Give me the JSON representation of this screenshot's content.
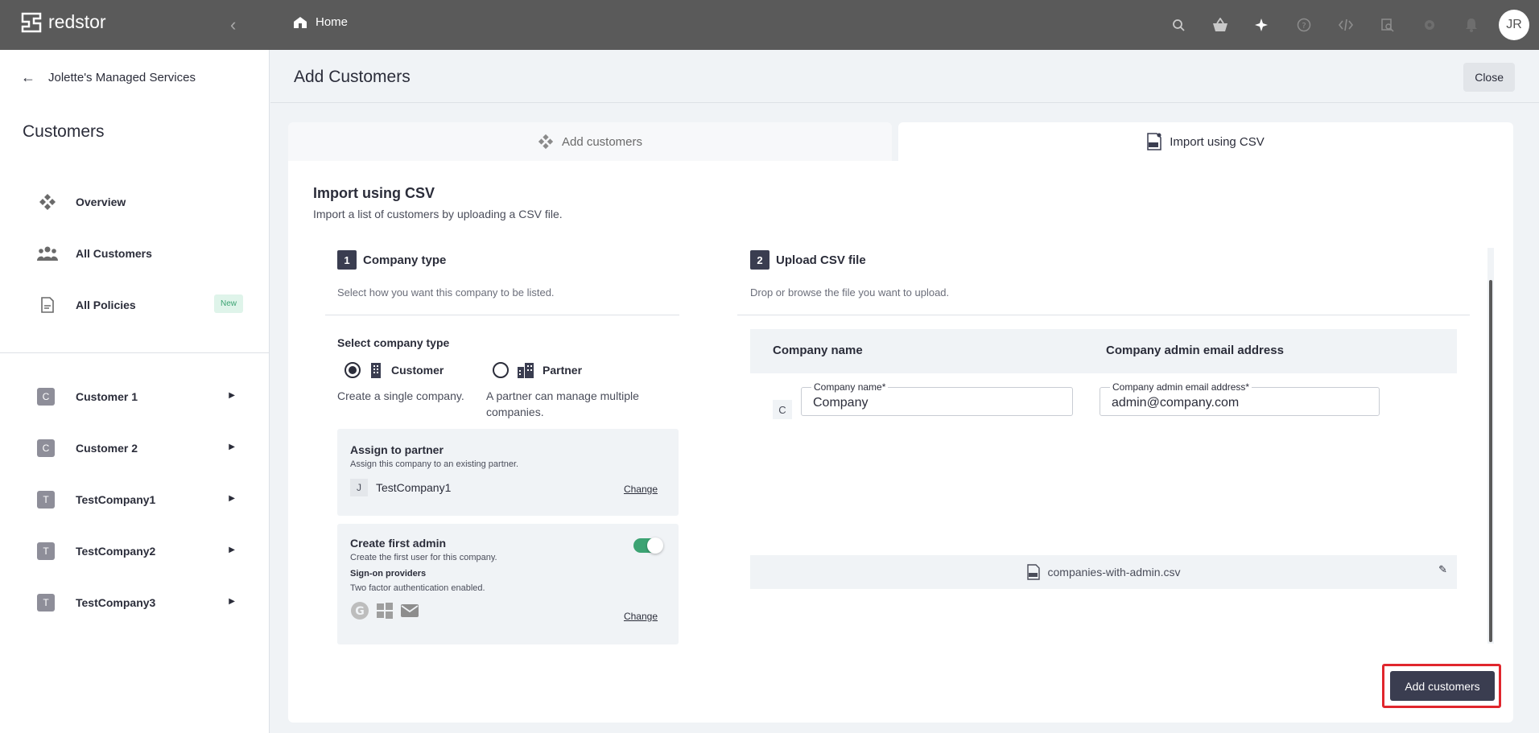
{
  "app": {
    "brand": "redstor",
    "breadcrumb_home": "Home",
    "user_initials": "JR"
  },
  "top_icons": [
    "search-icon",
    "basket-icon",
    "sparkle-icon",
    "help-icon",
    "code-icon",
    "inspect-icon",
    "gear-icon",
    "bell-icon"
  ],
  "sidebar": {
    "back_label": "Jolette's Managed Services",
    "title": "Customers",
    "nav": [
      {
        "label": "Overview",
        "icon": "overview-icon"
      },
      {
        "label": "All Customers",
        "icon": "people-icon"
      },
      {
        "label": "All Policies",
        "icon": "document-icon",
        "badge": "New"
      }
    ],
    "customers": [
      {
        "initial": "C",
        "label": "Customer 1"
      },
      {
        "initial": "C",
        "label": "Customer 2"
      },
      {
        "initial": "T",
        "label": "TestCompany1"
      },
      {
        "initial": "T",
        "label": "TestCompany2"
      },
      {
        "initial": "T",
        "label": "TestCompany3"
      }
    ]
  },
  "main": {
    "title": "Add Customers",
    "close_label": "Close",
    "tabs": [
      {
        "label": "Add customers"
      },
      {
        "label": "Import using CSV"
      }
    ],
    "panel": {
      "title": "Import using CSV",
      "subtitle": "Import a list of customers by uploading a CSV file.",
      "step1": {
        "num": "1",
        "title": "Company type",
        "desc": "Select how you want this company to be listed.",
        "select_label": "Select company type",
        "options": [
          {
            "label": "Customer",
            "desc": "Create a single company.",
            "selected": true
          },
          {
            "label": "Partner",
            "desc": "A partner can manage multiple companies.",
            "selected": false
          }
        ],
        "assign": {
          "title": "Assign to partner",
          "desc": "Assign this company to an existing partner.",
          "partner_initial": "J",
          "partner_name": "TestCompany1",
          "change_label": "Change"
        },
        "admin": {
          "title": "Create first admin",
          "desc": "Create the first user for this company.",
          "signon_title": "Sign-on providers",
          "signon_desc": "Two factor authentication enabled.",
          "change_label": "Change",
          "enabled": true
        }
      },
      "step2": {
        "num": "2",
        "title": "Upload CSV file",
        "desc": "Drop or browse the file you want to upload.",
        "columns": [
          "Company name",
          "Company admin email address"
        ],
        "row": {
          "initial": "C",
          "company_label": "Company name*",
          "company_value": "Company",
          "email_label": "Company admin email address*",
          "email_value": "admin@company.com"
        },
        "file_name": "companies-with-admin.csv"
      },
      "submit_label": "Add customers"
    }
  },
  "colors": {
    "topbar": "#5a5a5a",
    "primary": "#3a3d50",
    "accent_green": "#3ca373",
    "highlight": "#e0262d"
  }
}
